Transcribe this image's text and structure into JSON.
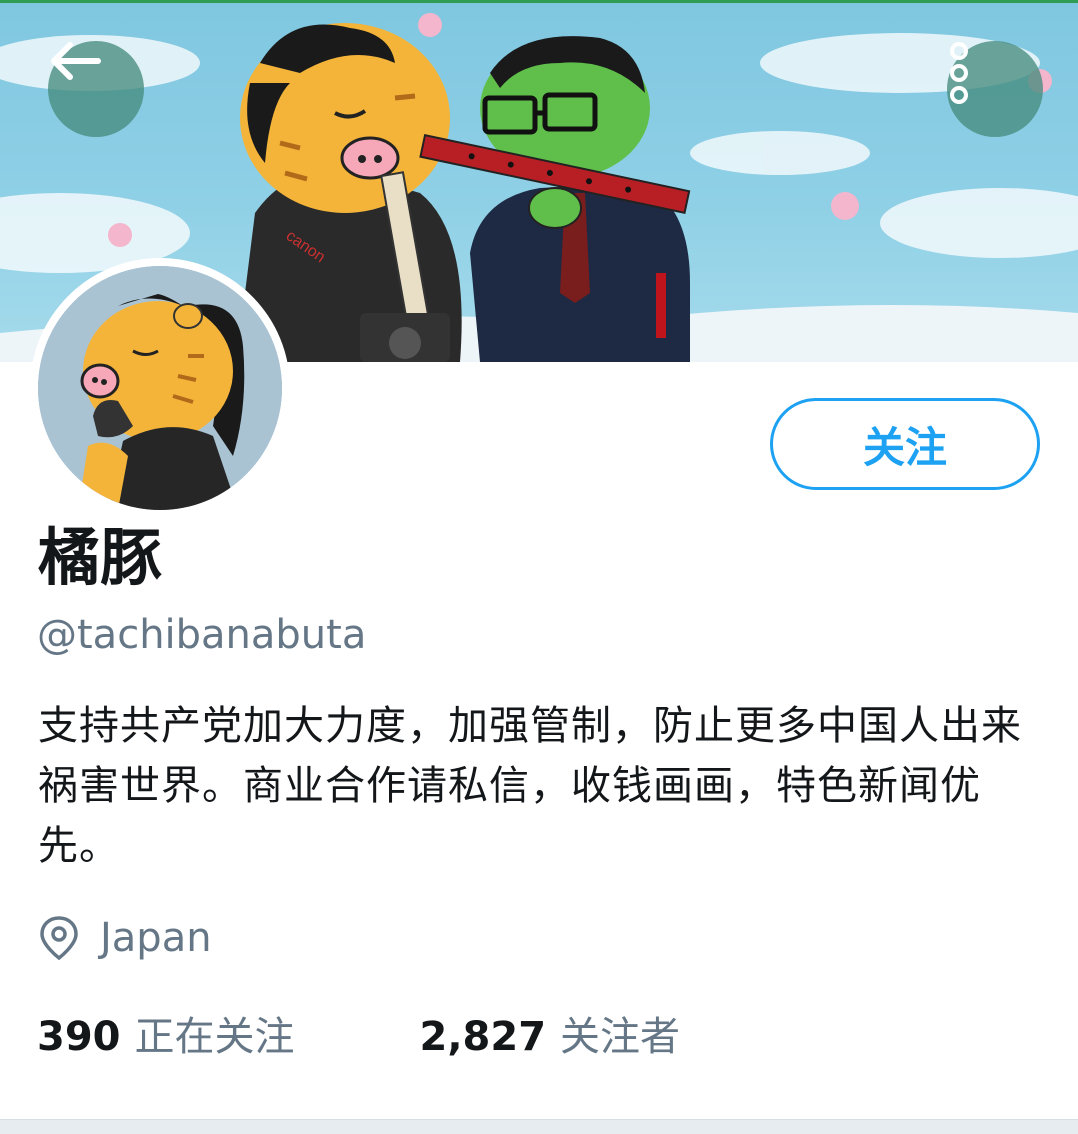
{
  "header": {
    "back_icon": "arrow-left-icon",
    "more_icon": "vertical-dots-icon"
  },
  "profile": {
    "display_name": "橘豚",
    "handle": "@tachibanabuta",
    "follow_label": "关注",
    "bio": "支持共产党加大力度，加强管制，防止更多中国人出来祸害世界。商业合作请私信，收钱画画，特色新闻优先。",
    "location": "Japan",
    "location_icon": "map-pin-icon",
    "camera_brand": "canon"
  },
  "stats": {
    "following_count": "390",
    "following_label": "正在关注",
    "followers_count": "2,827",
    "followers_label": "关注者"
  },
  "colors": {
    "accent": "#1da1f2",
    "text_primary": "#14171a",
    "text_secondary": "#657786",
    "button_overlay": "#468c7d"
  }
}
